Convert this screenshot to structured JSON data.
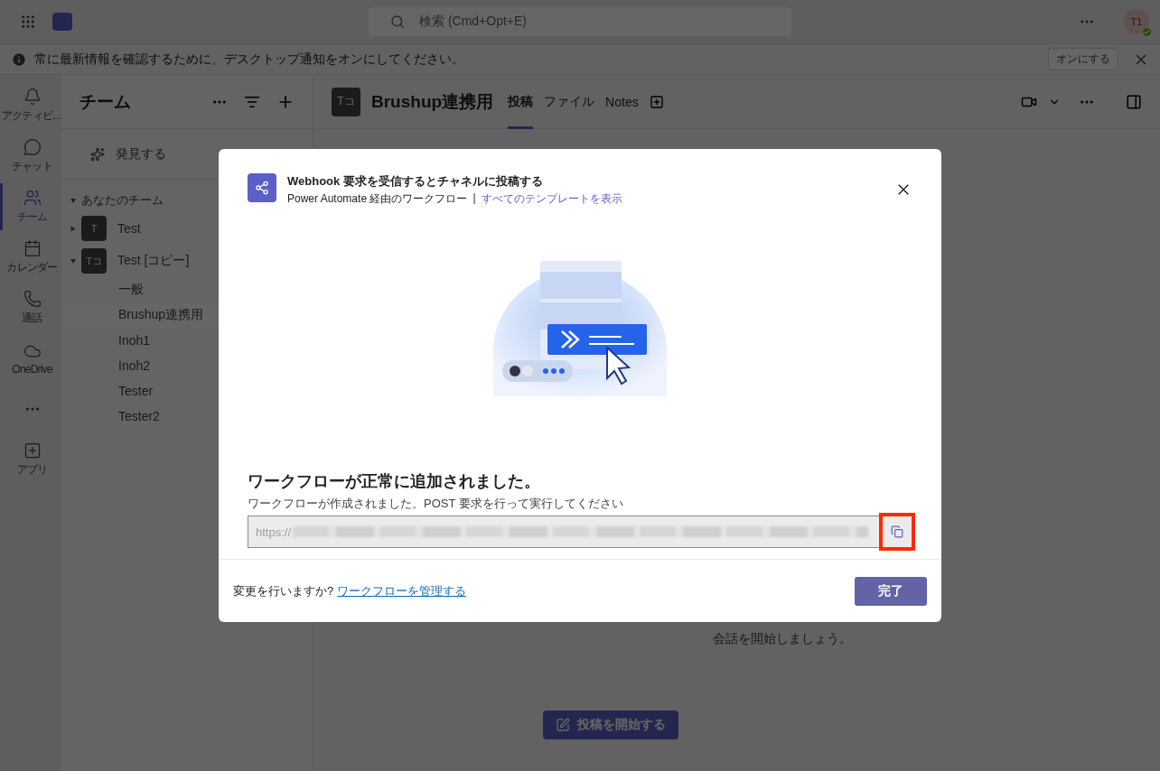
{
  "top_bar": {
    "search": {
      "placeholder": "検索 (Cmd+Opt+E)"
    },
    "avatar": {
      "initials": "T1",
      "online": true
    }
  },
  "banner": {
    "text": "常に最新情報を確認するために、デスクトップ通知をオンにしてください。",
    "button": "オンにする"
  },
  "rail": [
    {
      "kind": "bell",
      "label": "アクティビ…",
      "selected": false
    },
    {
      "kind": "chat",
      "label": "チャット",
      "selected": false
    },
    {
      "kind": "teams",
      "label": "チーム",
      "selected": true
    },
    {
      "kind": "calendar",
      "label": "カレンダー",
      "selected": false
    },
    {
      "kind": "phone",
      "label": "通話",
      "selected": false
    },
    {
      "kind": "cloud",
      "label": "OneDrive",
      "selected": false
    },
    {
      "kind": "more",
      "selected": false
    },
    {
      "kind": "apps",
      "label": "アプリ",
      "selected": false
    }
  ],
  "teams_panel": {
    "title": "チーム",
    "discover": "発見する",
    "section": "あなたのチーム",
    "teams": [
      {
        "name": "Test",
        "avatar": "T",
        "expanded": false
      },
      {
        "name": "Test [コピー]",
        "avatar": "Tコ",
        "expanded": true,
        "channels": [
          {
            "name": "一般",
            "selected": false
          },
          {
            "name": "Brushup連携用",
            "selected": true
          },
          {
            "name": "Inoh1",
            "selected": false
          },
          {
            "name": "Inoh2",
            "selected": false
          },
          {
            "name": "Tester",
            "selected": false
          },
          {
            "name": "Tester2",
            "selected": false
          }
        ]
      }
    ]
  },
  "channel": {
    "avatar": "Tコ",
    "title": "Brushup連携用",
    "tabs": [
      {
        "label": "投稿",
        "selected": true
      },
      {
        "label": "ファイル",
        "selected": false
      },
      {
        "label": "Notes",
        "selected": false
      }
    ],
    "prompt": "会話を開始しましょう。",
    "start_button": "投稿を開始する"
  },
  "dialog": {
    "title": "Webhook 要求を受信するとチャネルに投稿する",
    "subtitle": "Power Automate 経由のワークフロー",
    "separator": "|",
    "templates_link": "すべてのテンプレートを表示",
    "heading": "ワークフローが正常に追加されました。",
    "description": "ワークフローが作成されました。POST 要求を行って実行してください",
    "url": "https://",
    "copy_highlighted": true,
    "footer_question": "変更を行いますか?",
    "manage_link": "ワークフローを管理する",
    "done_button": "完了"
  }
}
